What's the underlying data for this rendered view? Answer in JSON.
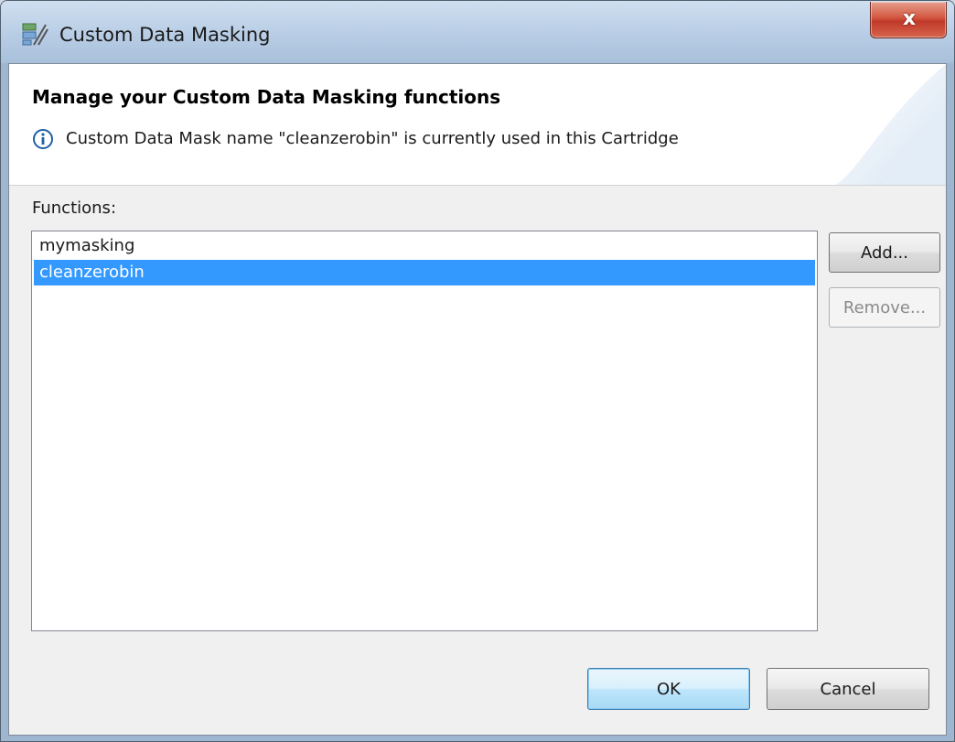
{
  "window": {
    "title": "Custom Data Masking",
    "close_label": "x"
  },
  "header": {
    "title": "Manage your Custom Data Masking functions",
    "message": "Custom Data Mask name \"cleanzerobin\" is currently used in this Cartridge"
  },
  "functions": {
    "label": "Functions:",
    "items": [
      {
        "label": "mymasking",
        "selected": false
      },
      {
        "label": "cleanzerobin",
        "selected": true
      }
    ]
  },
  "side_buttons": {
    "add_label": "Add...",
    "remove_label": "Remove..."
  },
  "footer": {
    "ok_label": "OK",
    "cancel_label": "Cancel"
  },
  "colors": {
    "selection": "#3399ff",
    "close_button": "#c0392a",
    "default_button": "#bee6fd"
  },
  "icons": {
    "title": "data-masking-icon",
    "info": "info-icon",
    "close": "close-icon"
  }
}
